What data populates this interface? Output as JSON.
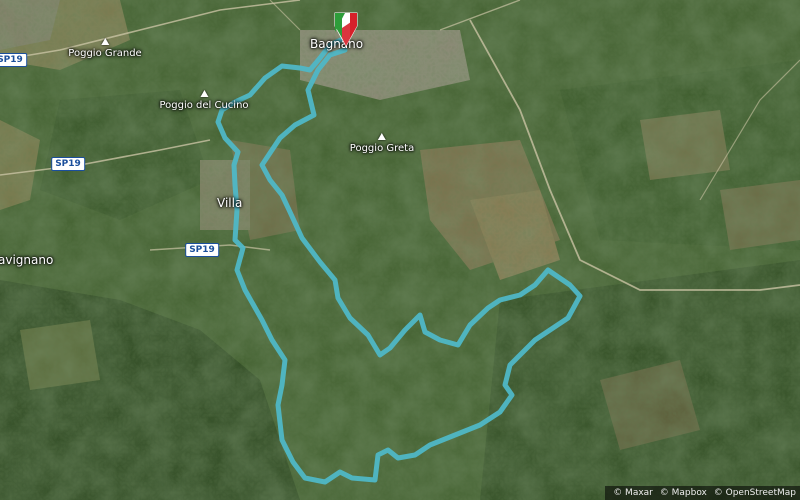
{
  "map": {
    "places": [
      {
        "id": "poggio-grande",
        "label": "Poggio Grande",
        "kind": "peak"
      },
      {
        "id": "poggio-del-cucino",
        "label": "Poggio del Cucino",
        "kind": "peak"
      },
      {
        "id": "poggio-greta",
        "label": "Poggio Greta",
        "kind": "peak"
      },
      {
        "id": "villa",
        "label": "Villa",
        "kind": "town"
      },
      {
        "id": "avignano",
        "label": "avignano",
        "kind": "town"
      },
      {
        "id": "bagnano",
        "label": "Bagnano",
        "kind": "town"
      }
    ],
    "roads": [
      {
        "id": "sp19-a",
        "label": "SP19"
      },
      {
        "id": "sp19-b",
        "label": "SP19"
      },
      {
        "id": "sp19-c",
        "label": "SP19"
      }
    ],
    "route_color": "#4fb7c6",
    "start_marker": {
      "colors": [
        "#2e9d3a",
        "#ffffff",
        "#d6202a"
      ]
    },
    "attribution": [
      "© Maxar",
      "© Mapbox",
      "© OpenStreetMap"
    ]
  }
}
